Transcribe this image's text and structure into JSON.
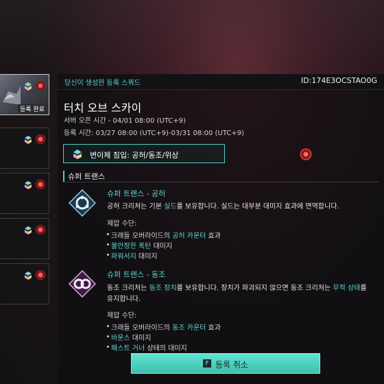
{
  "side_list": {
    "items": [
      {
        "status": "등록 완료",
        "active": true
      },
      {
        "status": "",
        "active": false
      },
      {
        "status": "",
        "active": false
      },
      {
        "status": "",
        "active": false
      },
      {
        "status": "",
        "active": false
      }
    ]
  },
  "panel": {
    "header_label": "당신이 생성한 등록 스쿼드",
    "id_text": "ID:174E3OCSTAO0G",
    "title": "터치 오브 스카이",
    "server_open": "서버 오픈 시간 - 04/01 08:00 (UTC+9)",
    "register_time": "등록 시간: 03/27 08:00 (UTC+9)-03/31 08:00 (UTC+9)",
    "mutation": "변이체 침입: 공허/동조/위상"
  },
  "super_trance": {
    "section_title": "슈퍼 트랜스",
    "traits": [
      {
        "name": "슈퍼 트랜스 - 공허",
        "desc_parts": [
          "공허 크리처는 기본 ",
          "실드",
          "를 보유합니다. 실드는 대부분 대미지 효과에 면역합니다."
        ],
        "counter_label": "제압 수단:",
        "bullets": [
          [
            "크래들 오버라이드의 ",
            "공허 카운터",
            " 효과"
          ],
          [
            "",
            "불안정한 폭탄",
            " 대미지"
          ],
          [
            "",
            "파워서지",
            " 대미지"
          ]
        ]
      },
      {
        "name": "슈퍼 트랜스 - 동조",
        "desc_parts": [
          "동조 크리처는 ",
          "동조 장치",
          "를 보유합니다. 장치가 파괴되지 않으면 동조 크리처는 ",
          "무적 상태",
          "를 유지합니다."
        ],
        "counter_label": "제압 수단:",
        "bullets": [
          [
            "크래들 오버라이드의 ",
            "동조 카운터",
            " 효과"
          ],
          [
            "",
            "바운스",
            " 대미지"
          ],
          [
            "",
            "패스트 거너",
            " 상태의 대미지"
          ]
        ]
      }
    ]
  },
  "cancel_button": {
    "key": "F",
    "label": "등록 취소"
  },
  "colors": {
    "accent": "#5fd4d0",
    "button": "#4fd0c2",
    "bg": "#1d1517"
  }
}
